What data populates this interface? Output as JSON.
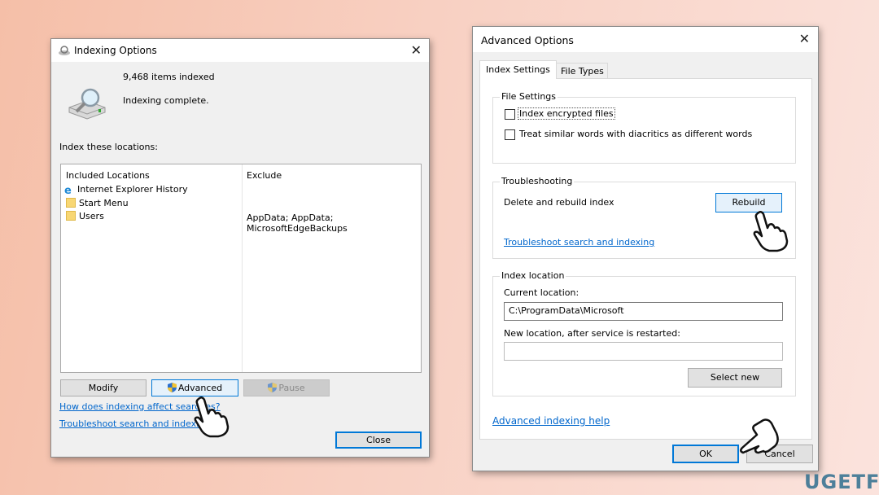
{
  "indexing_options": {
    "title": "Indexing Options",
    "items_indexed": "9,468 items indexed",
    "status": "Indexing complete.",
    "locations_label": "Index these locations:",
    "columns": {
      "included": "Included Locations",
      "exclude": "Exclude"
    },
    "locations": [
      {
        "name": "Internet Explorer History",
        "exclude": "",
        "icon": "internet-explorer-icon"
      },
      {
        "name": "Start Menu",
        "exclude": "",
        "icon": "folder-icon"
      },
      {
        "name": "Users",
        "exclude": "AppData; AppData; MicrosoftEdgeBackups",
        "icon": "folder-icon"
      }
    ],
    "buttons": {
      "modify": "Modify",
      "advanced": "Advanced",
      "pause": "Pause",
      "close": "Close"
    },
    "links": {
      "how_affect": "How does indexing affect searches?",
      "troubleshoot": "Troubleshoot search and indexing"
    }
  },
  "advanced_options": {
    "title": "Advanced Options",
    "tabs": [
      {
        "label": "Index Settings",
        "active": true
      },
      {
        "label": "File Types",
        "active": false
      }
    ],
    "file_settings": {
      "label": "File Settings",
      "options": [
        {
          "label": "Index encrypted files",
          "checked": false
        },
        {
          "label": "Treat similar words with diacritics as different words",
          "checked": false
        }
      ]
    },
    "troubleshooting": {
      "label": "Troubleshooting",
      "rebuild_text": "Delete and rebuild index",
      "rebuild_button": "Rebuild",
      "link": "Troubleshoot search and indexing"
    },
    "index_location": {
      "label": "Index location",
      "current_label": "Current location:",
      "current_value": "C:\\ProgramData\\Microsoft",
      "new_label": "New location, after service is restarted:",
      "new_value": "",
      "select_new": "Select new"
    },
    "help_link": "Advanced indexing help",
    "ok": "OK",
    "cancel": "Cancel"
  },
  "watermark": "UGETFIX",
  "colors": {
    "accent": "#0078d7",
    "link": "#0066cc",
    "watermark": "#2f6f8f"
  }
}
